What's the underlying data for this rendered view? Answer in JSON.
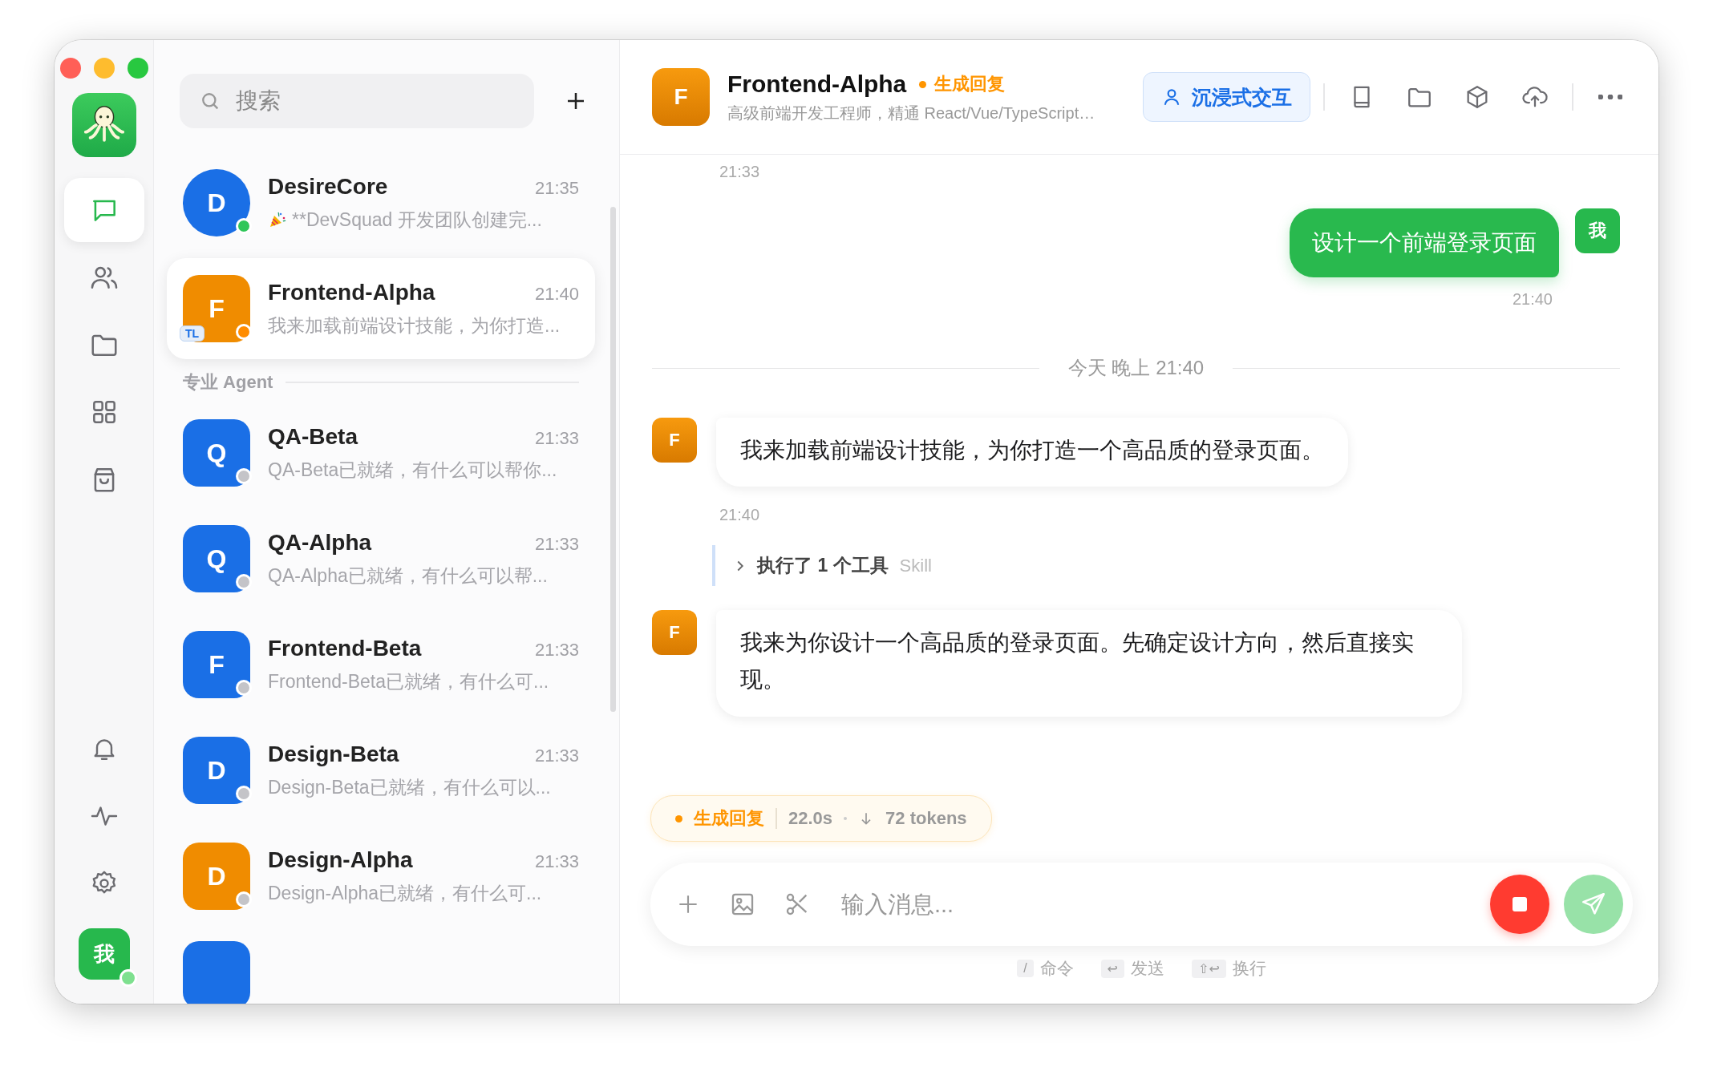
{
  "rail": {
    "nav": [
      {
        "selected": true
      },
      {
        "selected": false
      },
      {
        "selected": false
      },
      {
        "selected": false
      },
      {
        "selected": false
      }
    ],
    "user": {
      "label": "我",
      "online": true
    }
  },
  "search": {
    "placeholder": "搜索"
  },
  "chats": [
    {
      "kind": "chat",
      "name": "DesireCore",
      "time": "21:35",
      "preview": "**DevSquad 开发团队创建完...",
      "avatar": {
        "initial": "D",
        "color": "#1a6fe6",
        "round": true
      },
      "status": {
        "color": "#30c65a"
      },
      "selected": false
    },
    {
      "kind": "chat",
      "name": "Frontend-Alpha",
      "time": "21:40",
      "preview": "我来加载前端设计技能，为你打造...",
      "avatar": {
        "initial": "F",
        "color": "#f08c00",
        "round": false
      },
      "badge": "TL",
      "status": {
        "color": "#ff8c00"
      },
      "selected": true
    },
    {
      "kind": "section",
      "label": "专业 Agent"
    },
    {
      "kind": "chat",
      "name": "QA-Beta",
      "time": "21:33",
      "preview": "QA-Beta已就绪，有什么可以帮你...",
      "avatar": {
        "initial": "Q",
        "color": "#1a6fe6",
        "round": false
      },
      "status": {
        "color": "#c4c4c8"
      },
      "selected": false
    },
    {
      "kind": "chat",
      "name": "QA-Alpha",
      "time": "21:33",
      "preview": "QA-Alpha已就绪，有什么可以帮...",
      "avatar": {
        "initial": "Q",
        "color": "#1a6fe6",
        "round": false
      },
      "status": {
        "color": "#c4c4c8"
      },
      "selected": false
    },
    {
      "kind": "chat",
      "name": "Frontend-Beta",
      "time": "21:33",
      "preview": "Frontend-Beta已就绪，有什么可...",
      "avatar": {
        "initial": "F",
        "color": "#1a6fe6",
        "round": false
      },
      "status": {
        "color": "#c4c4c8"
      },
      "selected": false
    },
    {
      "kind": "chat",
      "name": "Design-Beta",
      "time": "21:33",
      "preview": "Design-Beta已就绪，有什么可以...",
      "avatar": {
        "initial": "D",
        "color": "#1a6fe6",
        "round": false
      },
      "status": {
        "color": "#c4c4c8"
      },
      "selected": false
    },
    {
      "kind": "chat",
      "name": "Design-Alpha",
      "time": "21:33",
      "preview": "Design-Alpha已就绪，有什么可...",
      "avatar": {
        "initial": "D",
        "color": "#f08c00",
        "round": false
      },
      "status": {
        "color": "#c4c4c8"
      },
      "selected": false
    }
  ],
  "header": {
    "initial": "F",
    "name": "Frontend-Alpha",
    "status": "生成回复",
    "subtitle": "高级前端开发工程师，精通 React/Vue/TypeScript…",
    "mode_button": "沉浸式交互"
  },
  "messages": [
    {
      "kind": "time",
      "text": "21:33"
    },
    {
      "kind": "user",
      "text": "设计一个前端登录页面",
      "avatar": "我",
      "time": "21:40"
    },
    {
      "kind": "divider",
      "text": "今天 晚上 21:40"
    },
    {
      "kind": "agent",
      "avatar": "F",
      "text": "我来加载前端设计技能，为你打造一个高品质的登录页面。",
      "time": "21:40"
    },
    {
      "kind": "tool",
      "label": "执行了 1 个工具",
      "tag": "Skill",
      "expanded": false
    },
    {
      "kind": "agent",
      "avatar": "F",
      "text": "我来为你设计一个高品质的登录页面。先确定设计方向，然后直接实现。"
    }
  ],
  "progress": {
    "status": "生成回复",
    "elapsed": "22.0s",
    "tokens": "72 tokens"
  },
  "composer": {
    "placeholder": "输入消息..."
  },
  "hints": [
    {
      "key": "/",
      "label": "命令"
    },
    {
      "key": "↩",
      "label": "发送"
    },
    {
      "key": "⇧↩",
      "label": "换行"
    }
  ]
}
